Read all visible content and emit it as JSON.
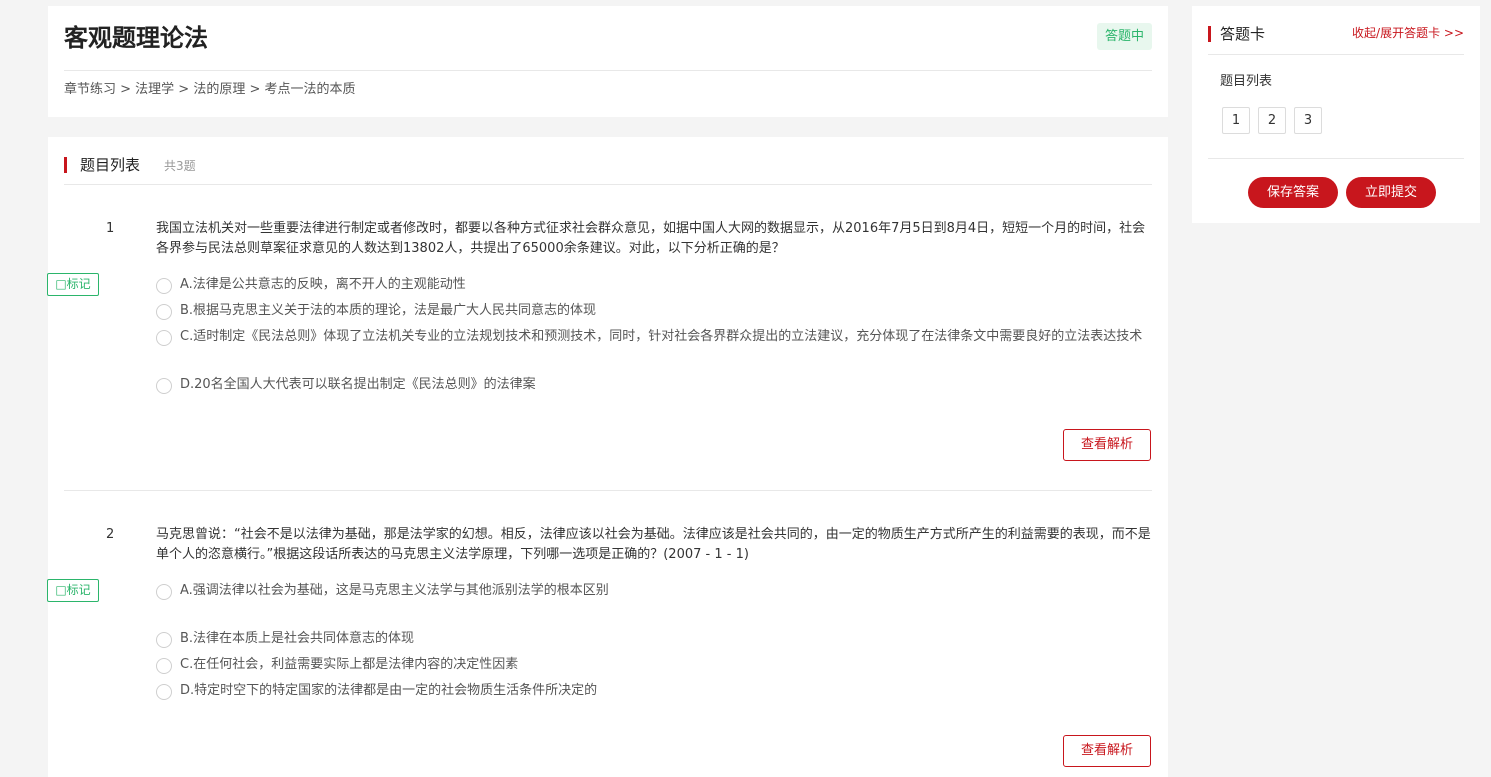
{
  "header": {
    "title": "客观题理论法",
    "status": "答题中",
    "breadcrumb": "章节练习 > 法理学 > 法的原理 > 考点一法的本质"
  },
  "list": {
    "title": "题目列表",
    "count": "共3题"
  },
  "questions": [
    {
      "number": "1",
      "stem": "我国立法机关对一些重要法律进行制定或者修改时，都要以各种方式征求社会群众意见，如据中国人大网的数据显示，从2016年7月5日到8月4日，短短一个月的时间，社会各界参与民法总则草案征求意见的人数达到13802人，共提出了65000余条建议。对此，以下分析正确的是？",
      "mark_label": "□标记",
      "options": [
        "A.法律是公共意志的反映，离不开人的主观能动性",
        "B.根据马克思主义关于法的本质的理论，法是最广大人民共同意志的体现",
        "C.适时制定《民法总则》体现了立法机关专业的立法规划技术和预测技术，同时，针对社会各界群众提出的立法建议，充分体现了在法律条文中需要良好的立法表达技术",
        "D.20名全国人大代表可以联名提出制定《民法总则》的法律案"
      ],
      "view_label": "查看解析"
    },
    {
      "number": "2",
      "stem": "马克思曾说：“社会不是以法律为基础，那是法学家的幻想。相反，法律应该以社会为基础。法律应该是社会共同的，由一定的物质生产方式所产生的利益需要的表现，而不是单个人的恣意横行。”根据这段话所表达的马克思主义法学原理，下列哪一选项是正确的？(2007 - 1 - 1)",
      "mark_label": "□标记",
      "options": [
        "A.强调法律以社会为基础，这是马克思主义法学与其他派别法学的根本区别",
        "B.法律在本质上是社会共同体意志的体现",
        "C.在任何社会，利益需要实际上都是法律内容的决定性因素",
        "D.特定时空下的特定国家的法律都是由一定的社会物质生活条件所决定的"
      ],
      "view_label": "查看解析"
    }
  ],
  "answer_card": {
    "title": "答题卡",
    "toggle": "收起/展开答题卡 >>",
    "list_label": "题目列表",
    "numbers": [
      "1",
      "2",
      "3"
    ],
    "save_label": "保存答案",
    "submit_label": "立即提交"
  },
  "colors": {
    "accent": "#c8161d",
    "status_green": "#2bb56b",
    "background": "#f4f4f4"
  }
}
